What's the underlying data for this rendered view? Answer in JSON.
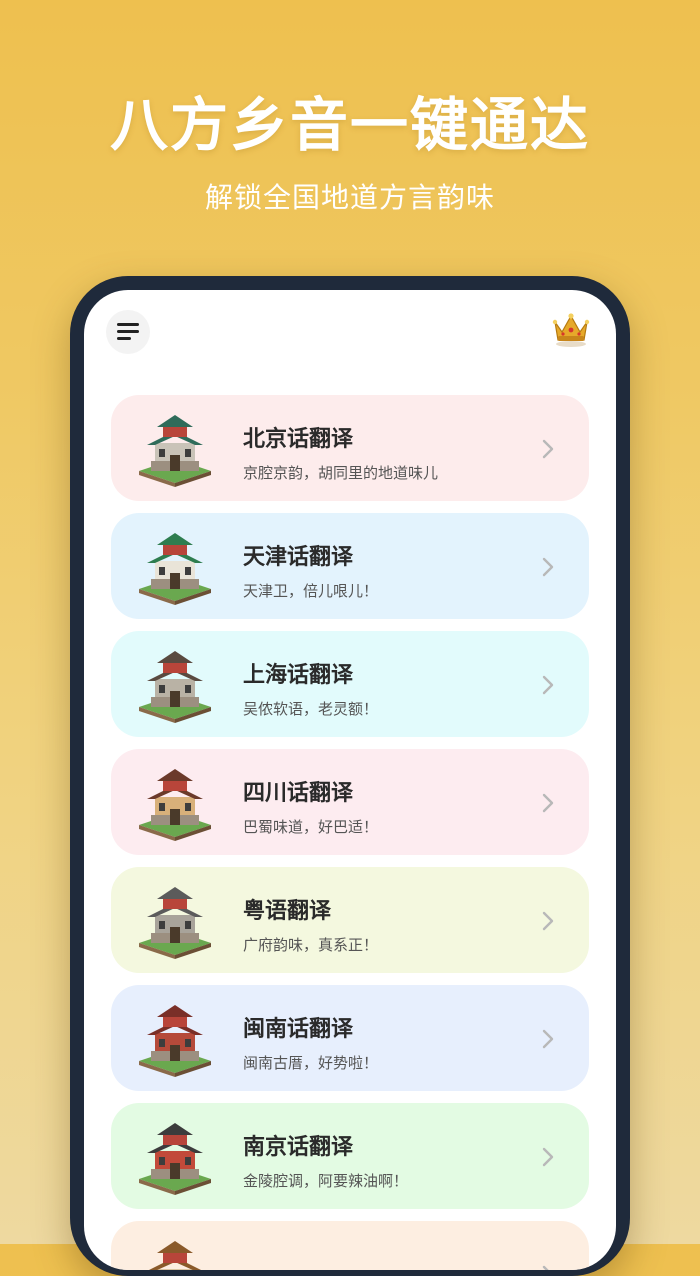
{
  "header": {
    "headline": "八方乡音一键通达",
    "subheadline": "解锁全国地道方言韵味"
  },
  "app": {
    "menu_icon": "menu-icon",
    "vip_icon": "crown-icon",
    "items": [
      {
        "title": "北京话翻译",
        "desc": "京腔京韵，胡同里的地道味儿",
        "bg": "#fdecec",
        "icon": "beijing-drum-tower-icon"
      },
      {
        "title": "天津话翻译",
        "desc": "天津卫，倍儿哏儿！",
        "bg": "#e3f3fd",
        "icon": "tianjin-tower-icon"
      },
      {
        "title": "上海话翻译",
        "desc": "吴侬软语，老灵额！",
        "bg": "#e2fbfc",
        "icon": "shanghai-shikumen-icon"
      },
      {
        "title": "四川话翻译",
        "desc": "巴蜀味道，好巴适！",
        "bg": "#fdecf0",
        "icon": "sichuan-pavilion-icon"
      },
      {
        "title": "粤语翻译",
        "desc": "广府韵味，真系正！",
        "bg": "#f4f8df",
        "icon": "guangdong-hall-icon"
      },
      {
        "title": "闽南话翻译",
        "desc": "闽南古厝，好势啦！",
        "bg": "#e7effd",
        "icon": "minnan-house-icon"
      },
      {
        "title": "南京话翻译",
        "desc": "金陵腔调，阿要辣油啊！",
        "bg": "#e3fbe3",
        "icon": "nanjing-gate-icon"
      },
      {
        "title": "",
        "desc": "",
        "bg": "#fdeee1",
        "icon": "building-icon"
      }
    ]
  }
}
